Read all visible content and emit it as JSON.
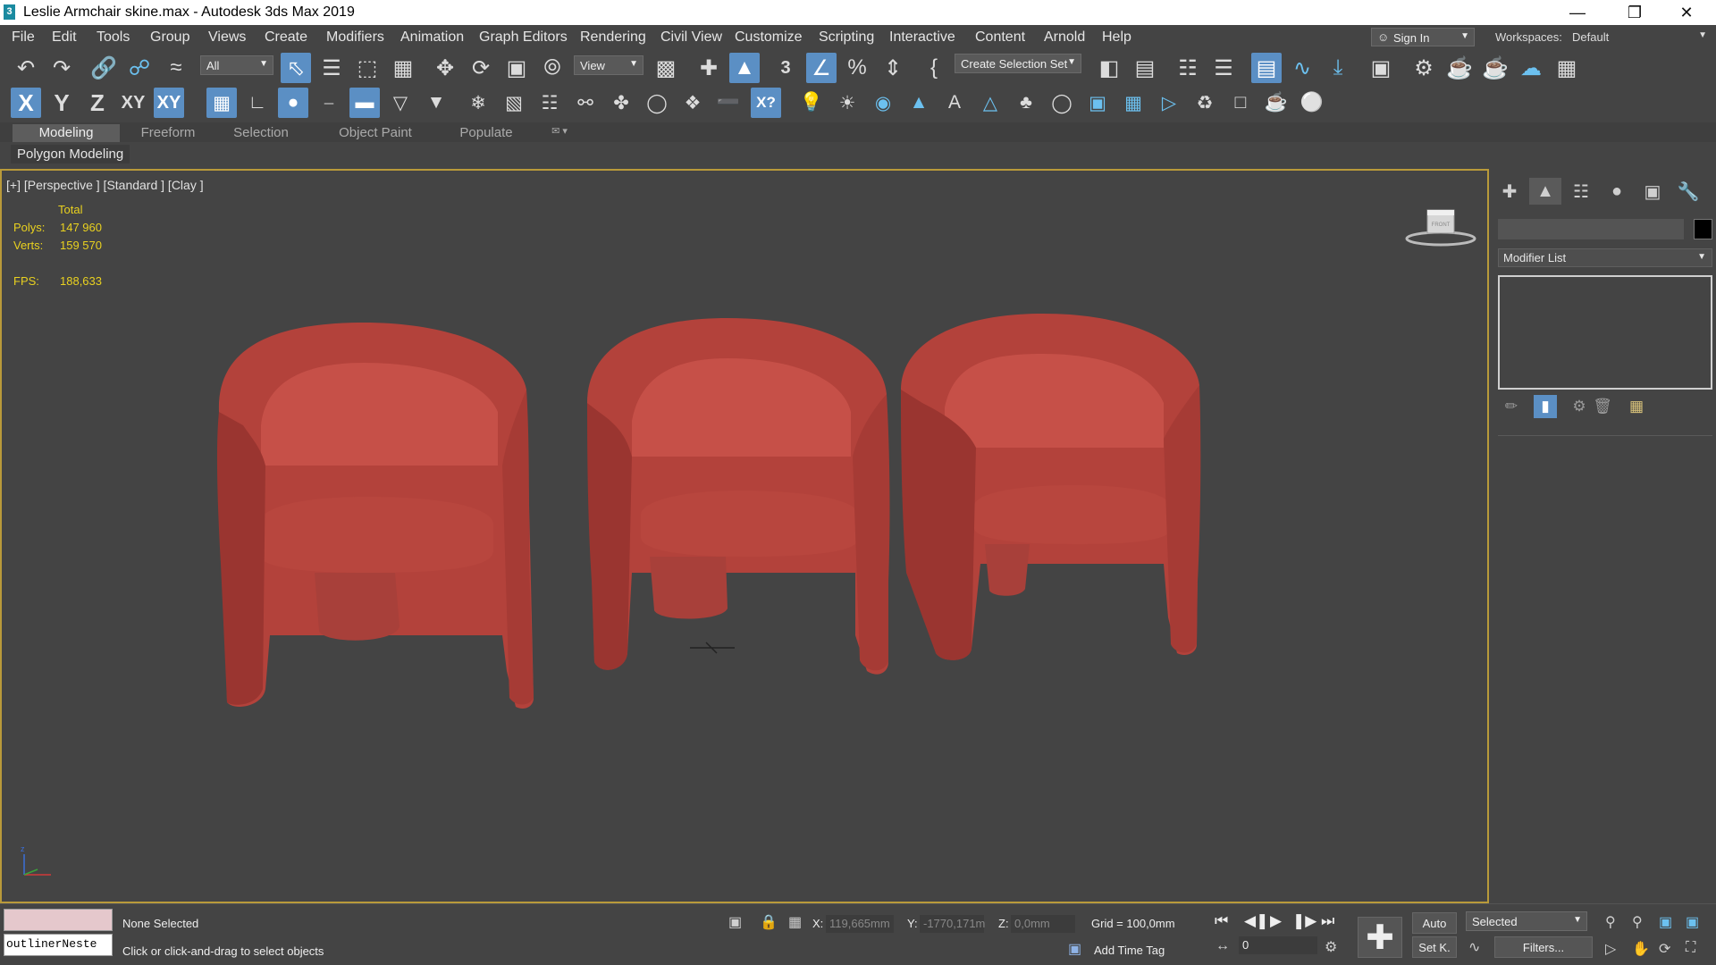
{
  "window": {
    "title": "Leslie Armchair skine.max - Autodesk 3ds Max 2019",
    "app_icon": "3",
    "minimize_icon": "minimize-icon",
    "restore_icon": "restore-icon",
    "close_icon": "close-icon"
  },
  "menu": {
    "items": [
      "File",
      "Edit",
      "Tools",
      "Group",
      "Views",
      "Create",
      "Modifiers",
      "Animation",
      "Graph Editors",
      "Rendering",
      "Civil View",
      "Customize",
      "Scripting",
      "Interactive",
      "Content",
      "Arnold",
      "Help"
    ],
    "sign_in": "Sign In",
    "workspaces_label": "Workspaces:",
    "workspace_value": "Default"
  },
  "toolbar1": {
    "selection_filter": "All",
    "ref_coord": "View",
    "selection_set": "Create Selection Set"
  },
  "toolbar2": {
    "axis_x": "X",
    "axis_y": "Y",
    "axis_z": "Z",
    "axis_xy": "XY",
    "axis_xy_lock": "XY"
  },
  "ribbon": {
    "tabs": [
      "Modeling",
      "Freeform",
      "Selection",
      "Object Paint",
      "Populate"
    ],
    "active_tab": "Modeling",
    "panel_label": "Polygon Modeling"
  },
  "viewport": {
    "label": "[+] [Perspective ] [Standard ] [Clay ]",
    "stats": {
      "total_label": "Total",
      "polys_label": "Polys:",
      "polys_value": "147 960",
      "verts_label": "Verts:",
      "verts_value": "159 570",
      "fps_label": "FPS:",
      "fps_value": "188,633"
    },
    "object_color": "#b9413a",
    "highlight_border": "#b99a3a"
  },
  "command_panel": {
    "modifier_list": "Modifier List",
    "tabs": [
      "create-icon",
      "modify-icon",
      "hierarchy-icon",
      "motion-icon",
      "display-icon",
      "utilities-icon"
    ]
  },
  "status": {
    "selection": "None Selected",
    "prompt": "Click or click-and-drag to select objects",
    "listener_text": "outlinerNeste",
    "x_label": "X:",
    "x_value": "119,665mm",
    "y_label": "Y:",
    "y_value": "-1770,171m",
    "z_label": "Z:",
    "z_value": "0,0mm",
    "grid": "Grid = 100,0mm",
    "add_time_tag": "Add Time Tag",
    "frame": "0",
    "auto": "Auto",
    "set_key": "Set K.",
    "key_filter": "Selected",
    "filters": "Filters..."
  }
}
